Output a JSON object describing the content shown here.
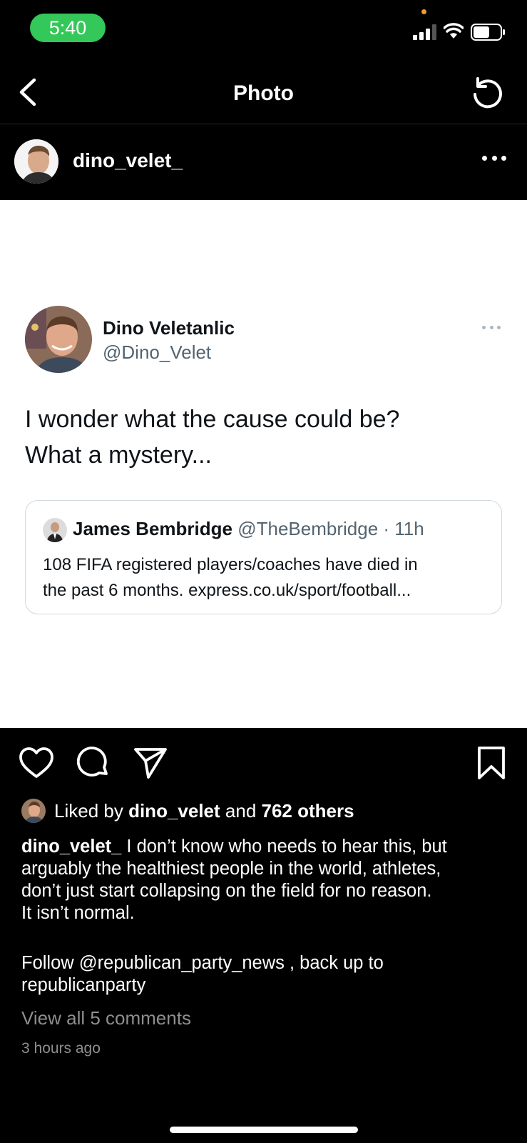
{
  "status_bar": {
    "time": "5:40"
  },
  "nav": {
    "title": "Photo"
  },
  "post": {
    "username": "dino_velet_",
    "tweet": {
      "name": "Dino Veletanlic",
      "handle": "@Dino_Velet",
      "text_lines": [
        "I wonder what the cause could be?",
        "What a mystery..."
      ],
      "quote": {
        "name": "James Bembridge",
        "meta": "@TheBembridge · 11h",
        "text_lines": [
          "108 FIFA registered players/coaches have died in",
          "the past 6 months. express.co.uk/sport/football..."
        ]
      }
    },
    "likes": {
      "prefix": "Liked by ",
      "user": "dino_velet",
      "middle": " and ",
      "others": "762 others"
    },
    "caption": {
      "user": "dino_velet_",
      "line1": " I don’t know who needs to hear this, but",
      "line2": "arguably the healthiest people in the world, athletes,",
      "line3": "don’t just start collapsing on the field for no reason.",
      "line4": "It isn’t normal.",
      "line5": "Follow @republican_party_news , back up to",
      "line6": "republicanparty"
    },
    "view_comments": "View all 5 comments",
    "time_ago": "3 hours ago"
  },
  "icons": {
    "back": "chevron-left-icon",
    "refresh": "refresh-icon",
    "more": "more-horizontal-icon",
    "like": "heart-icon",
    "comment": "comment-icon",
    "share": "paper-plane-icon",
    "save": "bookmark-icon"
  },
  "colors": {
    "time_pill": "#34c759",
    "background": "#000000",
    "secondary_text": "#8e8e8e",
    "twitter_gray": "#536471"
  }
}
